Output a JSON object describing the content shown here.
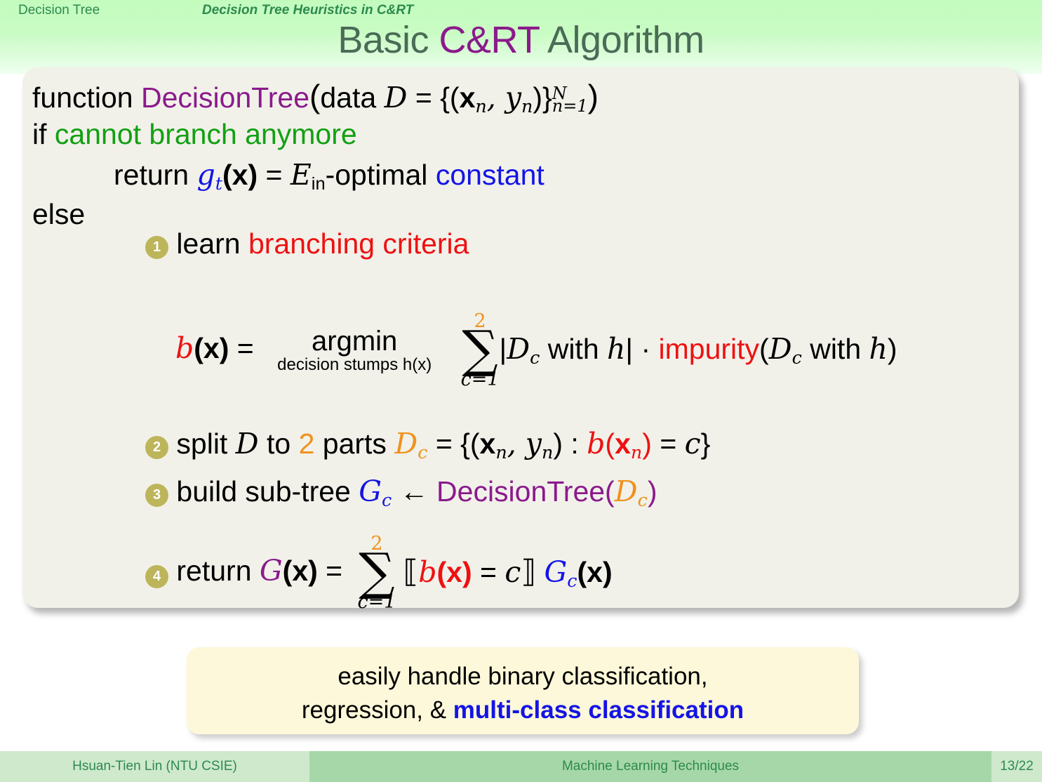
{
  "header": {
    "nav_section": "Decision Tree",
    "nav_subsection": "Decision Tree Heuristics in C&RT",
    "title_part1": "Basic ",
    "title_accent": "C&RT",
    "title_part2": " Algorithm"
  },
  "algorithm": {
    "line1": {
      "keyword": "function",
      "name": "DecisionTree",
      "paren_open": "(",
      "arg_label": "data",
      "dataset": "D",
      "equals": "=",
      "set_open": "{(",
      "x": "x",
      "x_sub": "n",
      "comma": ", ",
      "y": "y",
      "y_sub": "n",
      "set_close": ")}",
      "sup": "N",
      "sub": "n=1",
      "paren_close": ")"
    },
    "line2": {
      "keyword": "if",
      "condition": "cannot branch anymore"
    },
    "line3": {
      "keyword": "return",
      "g": "g",
      "g_sub": "t",
      "gx": "(x)",
      "equals": "=",
      "E": "E",
      "E_sub": "in",
      "optimal": "-optimal",
      "constant": "constant"
    },
    "line4": {
      "keyword": "else"
    },
    "steps": [
      {
        "num": "1",
        "text_black": "learn ",
        "text_color": "branching criteria"
      },
      {
        "num": "2",
        "text": "split"
      },
      {
        "num": "3",
        "text": "build sub-tree"
      },
      {
        "num": "4",
        "text": "return"
      }
    ],
    "bx_equation": {
      "b": "b",
      "bx": "(x)",
      "equals": "=",
      "argmin": "argmin",
      "argmin_sub": "decision stumps h(x)",
      "sum_upper": "2",
      "sum_symbol": "∑",
      "sum_lower": "c=1",
      "term": "|D_c with h| · impurity(D_c with h)",
      "abs_open": "|",
      "D": "D",
      "D_sub": "c",
      "with_h": " with ",
      "h": "h",
      "abs_close": "|",
      "dot": " · ",
      "impurity": "impurity",
      "paren_open": "(",
      "paren_close": ")"
    },
    "step2_equation": {
      "split": "split ",
      "D": "D",
      "to": " to ",
      "two": "2",
      "parts": " parts ",
      "Dc": "D",
      "Dc_sub": "c",
      "equals": " = ",
      "set_open": "{(",
      "x": "x",
      "x_sub": "n",
      "comma": ", ",
      "y": "y",
      "y_sub": "n",
      "colon": ") : ",
      "b": "b",
      "bxn_open": "(",
      "bx": "x",
      "bx_sub": "n",
      "bxn_close": ")",
      "eq2": " = ",
      "c": "c",
      "set_close": "}"
    },
    "step3_equation": {
      "build": "build sub-tree ",
      "G": "G",
      "G_sub": "c",
      "arrow": " ← ",
      "name": "DecisionTree",
      "paren_open": "(",
      "D": "D",
      "D_sub": "c",
      "paren_close": ")"
    },
    "step4_equation": {
      "return": "return ",
      "G": "G",
      "Gx": "(x)",
      "equals": " = ",
      "sum_upper": "2",
      "sum_symbol": "∑",
      "sum_lower": "c=1",
      "bracket_open": "⟦",
      "b": "b",
      "bx": "(x)",
      "eq2": " = ",
      "c": "c",
      "bracket_close": "⟧",
      "Gc": "G",
      "Gc_sub": "c",
      "Gcx": "(x)"
    }
  },
  "callout": {
    "line1": "easily handle binary classification,",
    "line2_plain": "regression, & ",
    "line2_strong": "multi-class classification"
  },
  "footer": {
    "author": "Hsuan-Tien Lin  (NTU CSIE)",
    "course": "Machine Learning Techniques",
    "page": "13/22"
  },
  "colors": {
    "accent_purple": "#8b1a8b",
    "green": "#12a012",
    "blue": "#1414e6",
    "red": "#ee1111",
    "orange": "#f0921e",
    "title_green": "#4a6b56",
    "footer_green": "#2d8a4e",
    "bullet": "#bdb55a",
    "callout_bg": "#fdf8d9",
    "block_bg": "#f1f1ea"
  }
}
